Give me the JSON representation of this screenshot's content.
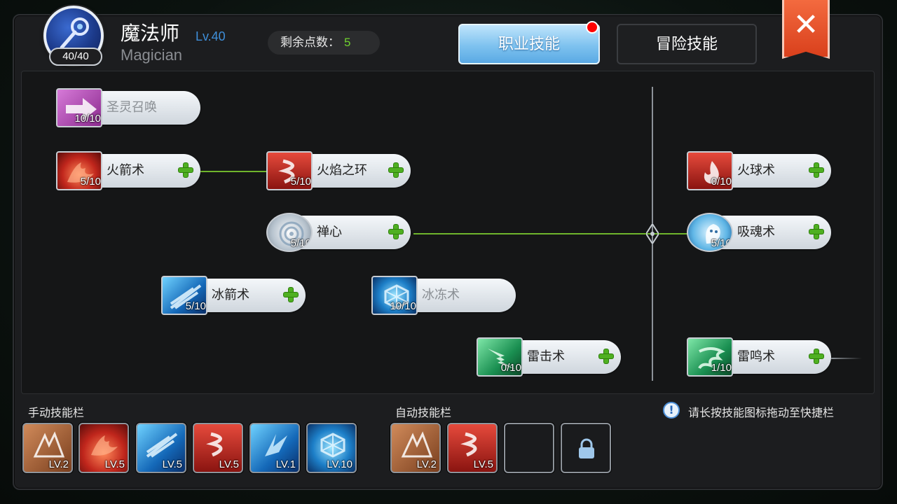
{
  "header": {
    "class_name": "魔法师",
    "level": "Lv.40",
    "class_name_en": "Magician",
    "hp": "40/40",
    "points_label": "剩余点数：",
    "points_value": "5"
  },
  "tabs": [
    {
      "label": "职业技能",
      "active": true,
      "has_notification": true
    },
    {
      "label": "冒险技能",
      "active": false
    }
  ],
  "close_label": "✕",
  "skills": [
    {
      "name": "圣灵召唤",
      "count": "10/10",
      "learnable": false,
      "icon": "holy-arrow-icon",
      "color": "#a94ba9"
    },
    {
      "name": "火箭术",
      "count": "5/10",
      "learnable": true,
      "icon": "fire-arrow-icon",
      "color": "#c0261c"
    },
    {
      "name": "火焰之环",
      "count": "5/10",
      "learnable": true,
      "icon": "flame-ring-icon",
      "color": "#c0261c"
    },
    {
      "name": "火球术",
      "count": "0/10",
      "learnable": true,
      "icon": "fireball-icon",
      "color": "#c0261c"
    },
    {
      "name": "禅心",
      "count": "5/10",
      "learnable": true,
      "icon": "zen-mind-icon",
      "color": "#b8c4cf"
    },
    {
      "name": "吸魂术",
      "count": "5/10",
      "learnable": true,
      "icon": "soul-drain-icon",
      "color": "#5fb6e6"
    },
    {
      "name": "冰箭术",
      "count": "5/10",
      "learnable": true,
      "icon": "ice-arrow-icon",
      "color": "#1468b8"
    },
    {
      "name": "冰冻术",
      "count": "10/10",
      "learnable": false,
      "icon": "freeze-icon",
      "color": "#1d7fc8"
    },
    {
      "name": "雷击术",
      "count": "0/10",
      "learnable": true,
      "icon": "lightning-strike-icon",
      "color": "#1a8f51"
    },
    {
      "name": "雷鸣术",
      "count": "1/10",
      "learnable": true,
      "icon": "thunder-roar-icon",
      "color": "#1a8f51"
    }
  ],
  "manual_bar": {
    "label": "手动技能栏",
    "slots": [
      {
        "lv": "LV.2",
        "icon": "earth-spike-icon"
      },
      {
        "lv": "LV.5",
        "icon": "fire-arrow-icon"
      },
      {
        "lv": "LV.5",
        "icon": "ice-arrow-icon"
      },
      {
        "lv": "LV.5",
        "icon": "flame-ring-icon"
      },
      {
        "lv": "LV.1",
        "icon": "ice-shard-icon"
      },
      {
        "lv": "LV.10",
        "icon": "freeze-icon"
      }
    ]
  },
  "auto_bar": {
    "label": "自动技能栏",
    "slots": [
      {
        "lv": "LV.2",
        "icon": "earth-spike-icon"
      },
      {
        "lv": "LV.5",
        "icon": "flame-ring-icon"
      },
      {
        "lv": "",
        "icon": "empty-slot"
      },
      {
        "lv": "",
        "icon": "lock-icon"
      }
    ]
  },
  "hint": {
    "icon": "info-icon",
    "text": "请长按技能图标拖动至快捷栏"
  }
}
